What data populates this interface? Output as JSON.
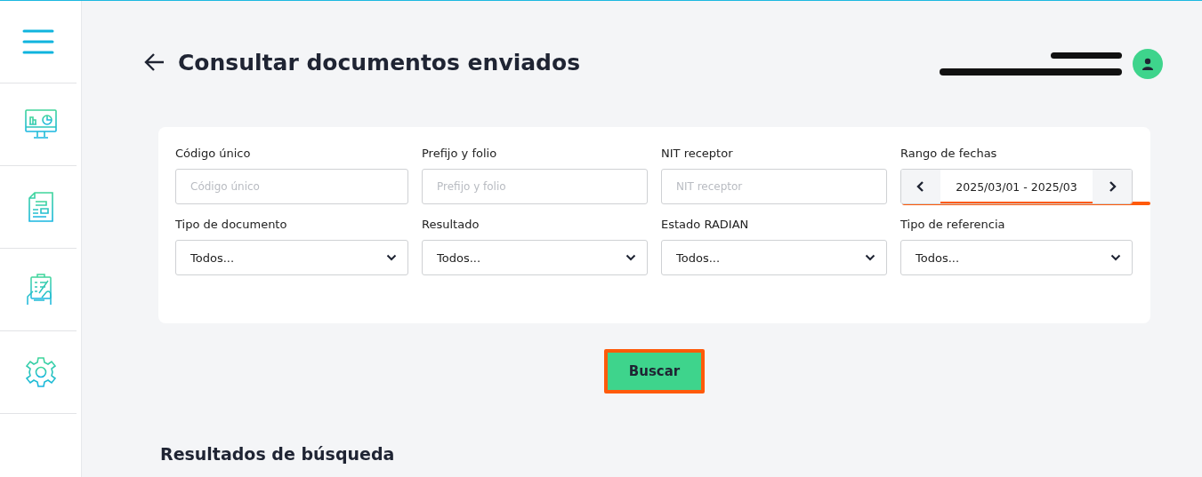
{
  "page": {
    "title": "Consultar documentos enviados"
  },
  "filters": [
    {
      "kind": "text",
      "label": "Código único",
      "placeholder": "Código único"
    },
    {
      "kind": "text",
      "label": "Prefijo y folio",
      "placeholder": "Prefijo y folio"
    },
    {
      "kind": "text",
      "label": "NIT receptor",
      "placeholder": "NIT receptor"
    },
    {
      "kind": "daterange",
      "label": "Rango de fechas",
      "value": "2025/03/01 - 2025/03"
    },
    {
      "kind": "select",
      "label": "Tipo de documento",
      "value": "Todos..."
    },
    {
      "kind": "select",
      "label": "Resultado",
      "value": "Todos..."
    },
    {
      "kind": "select",
      "label": "Estado RADIAN",
      "value": "Todos..."
    },
    {
      "kind": "select",
      "label": "Tipo de referencia",
      "value": "Todos..."
    }
  ],
  "search_button": "Buscar",
  "results": {
    "title": "Resultados de búsqueda"
  }
}
